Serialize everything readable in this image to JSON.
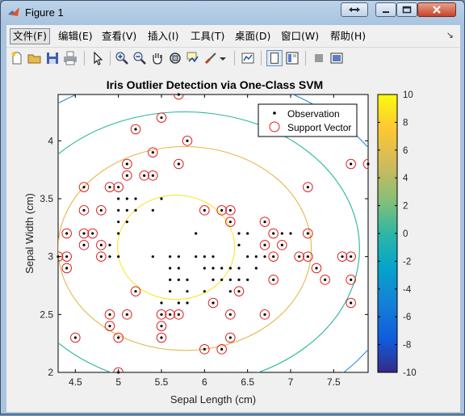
{
  "window": {
    "title": "Figure 1",
    "menus": [
      "文件(F)",
      "编辑(E)",
      "查看(V)",
      "插入(I)",
      "工具(T)",
      "桌面(D)",
      "窗口(W)",
      "帮助(H)"
    ],
    "toolbar": [
      "new-figure",
      "open-file",
      "save",
      "print",
      "select-arrow",
      "zoom-in",
      "zoom-out",
      "pan-hand",
      "rotate-3d",
      "data-cursor",
      "brush",
      "brush-dropdown",
      "link-plot",
      "hide-plot-tools",
      "show-plot-tools",
      "insert-colorbar",
      "insert-legend"
    ]
  },
  "chart_data": {
    "type": "scatter",
    "title": "Iris Outlier Detection via One-Class SVM",
    "xlabel": "Sepal Length (cm)",
    "ylabel": "Sepal Width (cm)",
    "xlim": [
      4.3,
      7.9
    ],
    "ylim": [
      2.0,
      4.4
    ],
    "xticks": [
      "4.5",
      "5",
      "5.5",
      "6",
      "6.5",
      "7",
      "7.5"
    ],
    "yticks": [
      "2",
      "2.5",
      "3",
      "3.5",
      "4"
    ],
    "legend": {
      "position": "top-right",
      "entries": [
        "Observation",
        "Support Vector"
      ]
    },
    "colorbar": {
      "min": -10,
      "max": 10,
      "ticks": [
        "10",
        "8",
        "6",
        "4",
        "2",
        "0",
        "-2",
        "-4",
        "-6",
        "-8",
        "-10"
      ],
      "colormap": "parula"
    },
    "observations": [
      [
        4.3,
        3.0
      ],
      [
        4.4,
        2.9
      ],
      [
        4.4,
        3.0
      ],
      [
        4.4,
        3.2
      ],
      [
        4.5,
        2.3
      ],
      [
        4.6,
        3.1
      ],
      [
        4.6,
        3.2
      ],
      [
        4.6,
        3.4
      ],
      [
        4.6,
        3.6
      ],
      [
        4.7,
        3.2
      ],
      [
        4.8,
        3.0
      ],
      [
        4.8,
        3.1
      ],
      [
        4.8,
        3.4
      ],
      [
        4.9,
        2.4
      ],
      [
        4.9,
        2.5
      ],
      [
        4.9,
        3.0
      ],
      [
        4.9,
        3.1
      ],
      [
        4.9,
        3.6
      ],
      [
        5.0,
        2.0
      ],
      [
        5.0,
        2.3
      ],
      [
        5.0,
        3.0
      ],
      [
        5.0,
        3.2
      ],
      [
        5.0,
        3.3
      ],
      [
        5.0,
        3.4
      ],
      [
        5.0,
        3.5
      ],
      [
        5.0,
        3.6
      ],
      [
        5.1,
        2.5
      ],
      [
        5.1,
        3.3
      ],
      [
        5.1,
        3.4
      ],
      [
        5.1,
        3.5
      ],
      [
        5.1,
        3.7
      ],
      [
        5.1,
        3.8
      ],
      [
        5.2,
        2.7
      ],
      [
        5.2,
        3.4
      ],
      [
        5.2,
        3.5
      ],
      [
        5.2,
        4.1
      ],
      [
        5.3,
        3.7
      ],
      [
        5.4,
        3.0
      ],
      [
        5.4,
        3.4
      ],
      [
        5.4,
        3.7
      ],
      [
        5.4,
        3.9
      ],
      [
        5.5,
        2.3
      ],
      [
        5.5,
        2.4
      ],
      [
        5.5,
        2.5
      ],
      [
        5.5,
        2.6
      ],
      [
        5.5,
        3.5
      ],
      [
        5.5,
        4.2
      ],
      [
        5.6,
        2.5
      ],
      [
        5.6,
        2.7
      ],
      [
        5.6,
        2.8
      ],
      [
        5.6,
        2.9
      ],
      [
        5.6,
        3.0
      ],
      [
        5.7,
        2.5
      ],
      [
        5.7,
        2.6
      ],
      [
        5.7,
        2.8
      ],
      [
        5.7,
        2.9
      ],
      [
        5.7,
        3.0
      ],
      [
        5.7,
        3.8
      ],
      [
        5.7,
        4.4
      ],
      [
        5.8,
        2.6
      ],
      [
        5.8,
        2.7
      ],
      [
        5.8,
        2.8
      ],
      [
        5.8,
        4.0
      ],
      [
        5.9,
        3.0
      ],
      [
        5.9,
        3.2
      ],
      [
        6.0,
        2.2
      ],
      [
        6.0,
        2.7
      ],
      [
        6.0,
        2.9
      ],
      [
        6.0,
        3.0
      ],
      [
        6.0,
        3.4
      ],
      [
        6.1,
        2.6
      ],
      [
        6.1,
        2.8
      ],
      [
        6.1,
        2.9
      ],
      [
        6.1,
        3.0
      ],
      [
        6.2,
        2.2
      ],
      [
        6.2,
        2.8
      ],
      [
        6.2,
        2.9
      ],
      [
        6.2,
        3.4
      ],
      [
        6.3,
        2.3
      ],
      [
        6.3,
        2.5
      ],
      [
        6.3,
        2.7
      ],
      [
        6.3,
        2.8
      ],
      [
        6.3,
        2.9
      ],
      [
        6.3,
        3.3
      ],
      [
        6.3,
        3.4
      ],
      [
        6.4,
        2.7
      ],
      [
        6.4,
        2.8
      ],
      [
        6.4,
        2.9
      ],
      [
        6.4,
        3.1
      ],
      [
        6.4,
        3.2
      ],
      [
        6.5,
        2.8
      ],
      [
        6.5,
        3.0
      ],
      [
        6.5,
        3.2
      ],
      [
        6.6,
        2.9
      ],
      [
        6.6,
        3.0
      ],
      [
        6.7,
        2.5
      ],
      [
        6.7,
        3.0
      ],
      [
        6.7,
        3.1
      ],
      [
        6.7,
        3.3
      ],
      [
        6.8,
        2.8
      ],
      [
        6.8,
        3.0
      ],
      [
        6.8,
        3.2
      ],
      [
        6.9,
        3.1
      ],
      [
        6.9,
        3.2
      ],
      [
        7.0,
        3.2
      ],
      [
        7.1,
        3.0
      ],
      [
        7.2,
        3.0
      ],
      [
        7.2,
        3.2
      ],
      [
        7.2,
        3.6
      ],
      [
        7.3,
        2.9
      ],
      [
        7.4,
        2.8
      ],
      [
        7.6,
        3.0
      ],
      [
        7.7,
        2.6
      ],
      [
        7.7,
        2.8
      ],
      [
        7.7,
        3.0
      ],
      [
        7.7,
        3.8
      ],
      [
        7.9,
        3.8
      ]
    ],
    "support_vectors": [
      [
        4.3,
        3.0
      ],
      [
        4.4,
        2.9
      ],
      [
        4.4,
        3.0
      ],
      [
        4.4,
        3.2
      ],
      [
        4.5,
        2.3
      ],
      [
        4.6,
        3.1
      ],
      [
        4.6,
        3.2
      ],
      [
        4.6,
        3.4
      ],
      [
        4.6,
        3.6
      ],
      [
        4.7,
        3.2
      ],
      [
        4.8,
        3.0
      ],
      [
        4.8,
        3.1
      ],
      [
        4.8,
        3.4
      ],
      [
        4.9,
        2.4
      ],
      [
        4.9,
        2.5
      ],
      [
        4.9,
        3.6
      ],
      [
        5.0,
        2.0
      ],
      [
        5.0,
        2.3
      ],
      [
        5.0,
        3.6
      ],
      [
        5.1,
        2.5
      ],
      [
        5.1,
        3.7
      ],
      [
        5.1,
        3.8
      ],
      [
        5.2,
        2.7
      ],
      [
        5.2,
        4.1
      ],
      [
        5.3,
        3.7
      ],
      [
        5.4,
        3.7
      ],
      [
        5.4,
        3.9
      ],
      [
        5.5,
        2.3
      ],
      [
        5.5,
        2.4
      ],
      [
        5.5,
        2.5
      ],
      [
        5.5,
        4.2
      ],
      [
        5.6,
        2.5
      ],
      [
        5.7,
        2.5
      ],
      [
        5.7,
        3.8
      ],
      [
        5.7,
        4.4
      ],
      [
        5.8,
        4.0
      ],
      [
        6.0,
        2.2
      ],
      [
        6.0,
        3.4
      ],
      [
        6.1,
        2.6
      ],
      [
        6.2,
        2.2
      ],
      [
        6.2,
        3.4
      ],
      [
        6.3,
        2.3
      ],
      [
        6.3,
        2.5
      ],
      [
        6.3,
        3.3
      ],
      [
        6.3,
        3.4
      ],
      [
        6.4,
        2.7
      ],
      [
        6.7,
        2.5
      ],
      [
        6.7,
        3.3
      ],
      [
        6.7,
        3.1
      ],
      [
        6.8,
        3.2
      ],
      [
        6.8,
        2.8
      ],
      [
        6.9,
        3.1
      ],
      [
        6.8,
        3.0
      ],
      [
        7.1,
        3.0
      ],
      [
        7.2,
        3.0
      ],
      [
        7.2,
        3.2
      ],
      [
        7.2,
        3.6
      ],
      [
        7.3,
        2.9
      ],
      [
        7.4,
        2.8
      ],
      [
        7.6,
        3.0
      ],
      [
        7.7,
        2.6
      ],
      [
        7.7,
        2.8
      ],
      [
        7.7,
        3.0
      ],
      [
        7.7,
        3.8
      ],
      [
        7.9,
        3.8
      ]
    ],
    "contours": [
      {
        "level": "8",
        "color": "#f9e62a",
        "cx": 5.67,
        "cy": 3.08,
        "rx": 0.68,
        "ry": 0.45
      },
      {
        "level": "6",
        "color": "#e5b64a",
        "cx": 5.77,
        "cy": 3.07,
        "rx": 1.47,
        "ry": 0.88
      },
      {
        "level": "4",
        "color": "#27b59c",
        "cx": 5.77,
        "cy": 3.07,
        "rx": 2.03,
        "ry": 1.18
      },
      {
        "level": "2",
        "color": "#2e8cd6",
        "cx": 5.77,
        "cy": 3.07,
        "rx": 2.6,
        "ry": 1.52
      }
    ]
  }
}
